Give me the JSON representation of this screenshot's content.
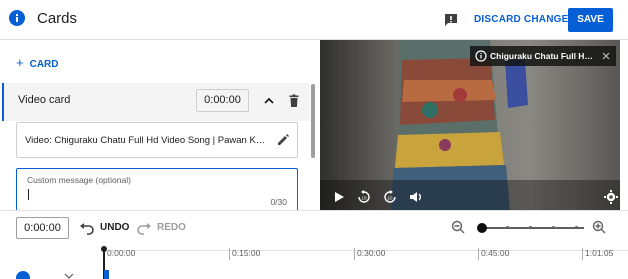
{
  "header": {
    "title": "Cards",
    "discard_label": "DISCARD CHANGES",
    "save_label": "SAVE",
    "accent_color": "#065fd4"
  },
  "left_panel": {
    "add_card_label": "CARD",
    "card": {
      "type_label": "Video card",
      "time": "0:00:00"
    },
    "video_field_text": "Video: Chiguraku Chatu Full Hd Video Song | Pawan Kalyan, M...",
    "custom_message": {
      "label": "Custom message (optional)",
      "value": "",
      "count": "0/30"
    }
  },
  "preview": {
    "info_title": "Chiguraku Chatu Full Hd V...",
    "controls": [
      "play-icon",
      "replay-10-icon",
      "forward-10-icon",
      "volume-icon",
      "settings-icon"
    ]
  },
  "timeline": {
    "current_time": "0:00:00",
    "undo_label": "UNDO",
    "redo_label": "REDO",
    "ruler": [
      "0:00:00",
      "0:15:00",
      "0:30:00",
      "0:45:00",
      "1:01:05"
    ]
  }
}
